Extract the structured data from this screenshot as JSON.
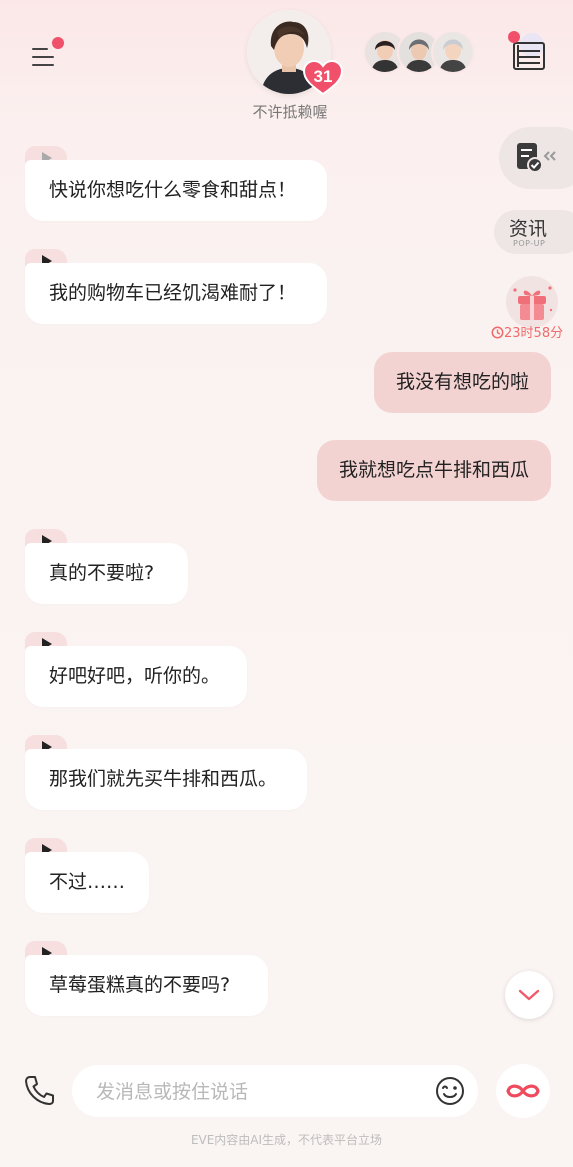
{
  "header": {
    "character_name": "不许抵赖喔",
    "affinity_count": "31"
  },
  "widgets": {
    "news_title": "资讯",
    "news_subtitle": "POP-UP",
    "gift_timer": "23时58分"
  },
  "messages": [
    {
      "from": "ai",
      "text": "快说你想吃什么零食和甜点！"
    },
    {
      "from": "ai",
      "text": "我的购物车已经饥渴难耐了！"
    },
    {
      "from": "me",
      "text": "我没有想吃的啦"
    },
    {
      "from": "me",
      "text": "我就想吃点牛排和西瓜"
    },
    {
      "from": "ai",
      "text": "真的不要啦?"
    },
    {
      "from": "ai",
      "text": "好吧好吧，听你的。"
    },
    {
      "from": "ai",
      "text": "那我们就先买牛排和西瓜。"
    },
    {
      "from": "ai",
      "text": "不过……"
    },
    {
      "from": "ai",
      "text": "草莓蛋糕真的不要吗?"
    }
  ],
  "input": {
    "placeholder": "发消息或按住说话",
    "value": ""
  },
  "footer": {
    "disclaimer": "EVE内容由AI生成，不代表平台立场"
  },
  "colors": {
    "accent": "#f0506a",
    "user_bubble": "#f3d3d2",
    "ai_bubble": "#ffffff",
    "play_tab": "#f6dfde"
  },
  "icons": [
    "menu-icon",
    "heart-icon",
    "book-icon",
    "task-check-icon",
    "gift-icon",
    "clock-icon",
    "play-icon",
    "chevron-down-icon",
    "phone-icon",
    "emoji-icon",
    "infinity-icon"
  ]
}
